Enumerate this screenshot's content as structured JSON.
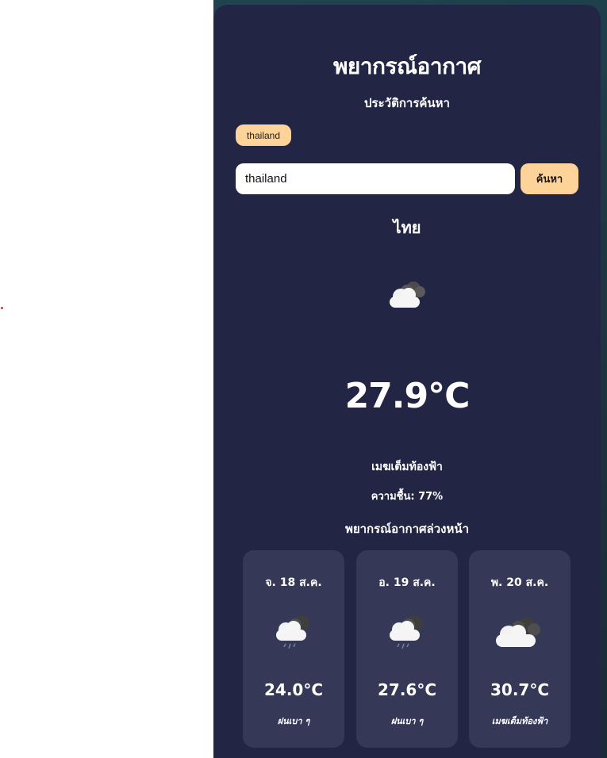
{
  "app": {
    "title": "พยากรณ์อากาศ"
  },
  "history": {
    "title": "ประวัติการค้นหา",
    "items": [
      "thailand"
    ]
  },
  "search": {
    "value": "thailand",
    "button_label": "ค้นหา"
  },
  "current": {
    "city": "ไทย",
    "icon": "cloud-overcast-icon",
    "temperature": "27.9°C",
    "description": "เมฆเต็มท้องฟ้า",
    "humidity_label": "ความชื้น:",
    "humidity_value": "77%"
  },
  "forecast": {
    "title": "พยากรณ์อากาศล่วงหน้า",
    "days": [
      {
        "date": "จ. 18 ส.ค.",
        "icon": "cloud-rain-icon",
        "temperature": "24.0°C",
        "description": "ฝนเบา ๆ"
      },
      {
        "date": "อ. 19 ส.ค.",
        "icon": "cloud-rain-icon",
        "temperature": "27.6°C",
        "description": "ฝนเบา ๆ"
      },
      {
        "date": "พ. 20 ส.ค.",
        "icon": "cloud-overcast-icon",
        "temperature": "30.7°C",
        "description": "เมฆเต็มท้องฟ้า"
      }
    ]
  },
  "colors": {
    "card_bg": "#222644",
    "forecast_card_bg": "#353957",
    "accent": "#fdd39a",
    "page_bg_right": "#1d3640"
  }
}
